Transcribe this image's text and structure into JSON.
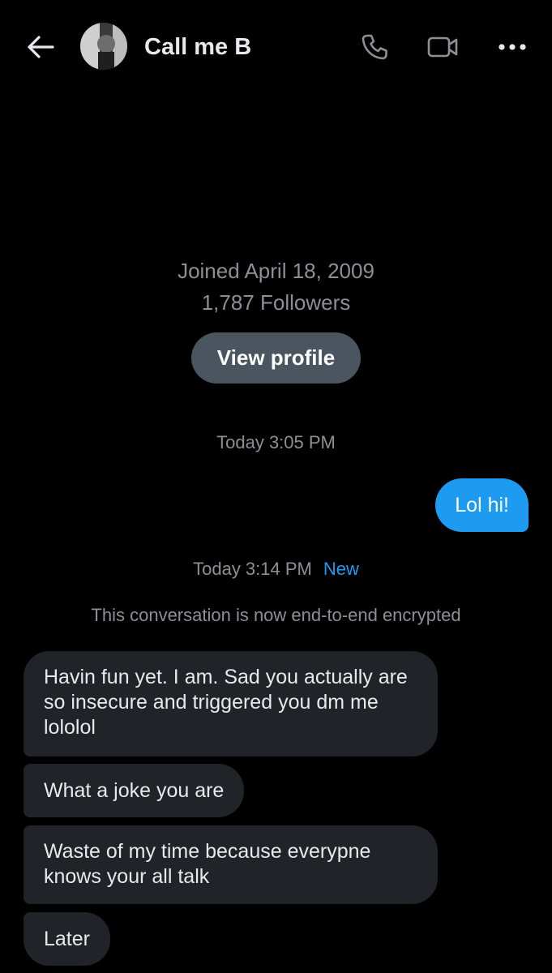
{
  "header": {
    "title": "Call me B",
    "back_icon": "arrow-left-icon",
    "call_icon": "phone-icon",
    "video_icon": "video-camera-icon",
    "more_icon": "more-horizontal-icon"
  },
  "profile": {
    "joined": "Joined April 18, 2009",
    "followers": "1,787 Followers",
    "view_profile_label": "View profile"
  },
  "conversation": {
    "timestamp_1": "Today 3:05 PM",
    "outgoing": [
      {
        "text": "Lol hi!"
      }
    ],
    "timestamp_2": "Today 3:14 PM",
    "new_label": "New",
    "encryption_note": "This conversation is now end-to-end encrypted",
    "incoming": [
      {
        "text": "Havin fun yet. I am. Sad you actually are so insecure and triggered you dm me lololol"
      },
      {
        "text": "What a joke you are"
      },
      {
        "text": "Waste of my time because everypne knows your all talk"
      },
      {
        "text": "Later"
      }
    ]
  },
  "colors": {
    "background": "#000000",
    "outgoing_bubble": "#1d9bf0",
    "incoming_bubble": "#202327",
    "view_profile_button": "#4a5560",
    "muted_text": "#8b9096",
    "accent": "#1d9bf0"
  }
}
